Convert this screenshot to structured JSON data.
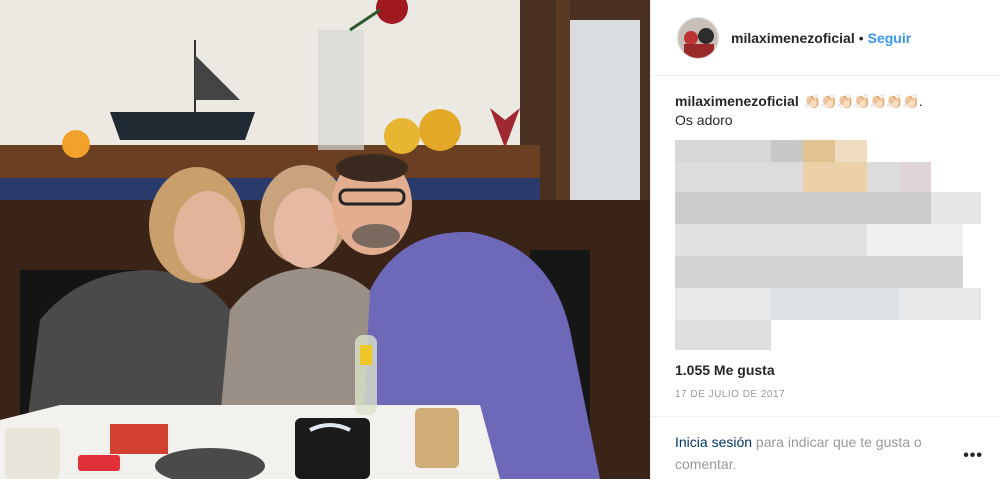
{
  "post": {
    "photo_alt": "Fotografía de tres personas en un restaurante",
    "author": {
      "username": "milaximenezoficial",
      "separator": "•",
      "follow_label": "Seguir"
    },
    "caption": {
      "username": "milaximenezoficial",
      "emoji": "👏🏻👏🏻👏🏻👏🏻👏🏻👏🏻👏🏻.",
      "text": "Os adoro"
    },
    "likes": "1.055 Me gusta",
    "date": "17 DE JULIO DE 2017",
    "login_prompt": {
      "link": "Inicia sesión",
      "text": " para indicar que te gusta o comentar."
    },
    "more_icon": "ellipsis-icon"
  },
  "colors": {
    "link_blue": "#3897f0",
    "text": "#262626",
    "muted": "#999999",
    "login_link": "#003569"
  }
}
